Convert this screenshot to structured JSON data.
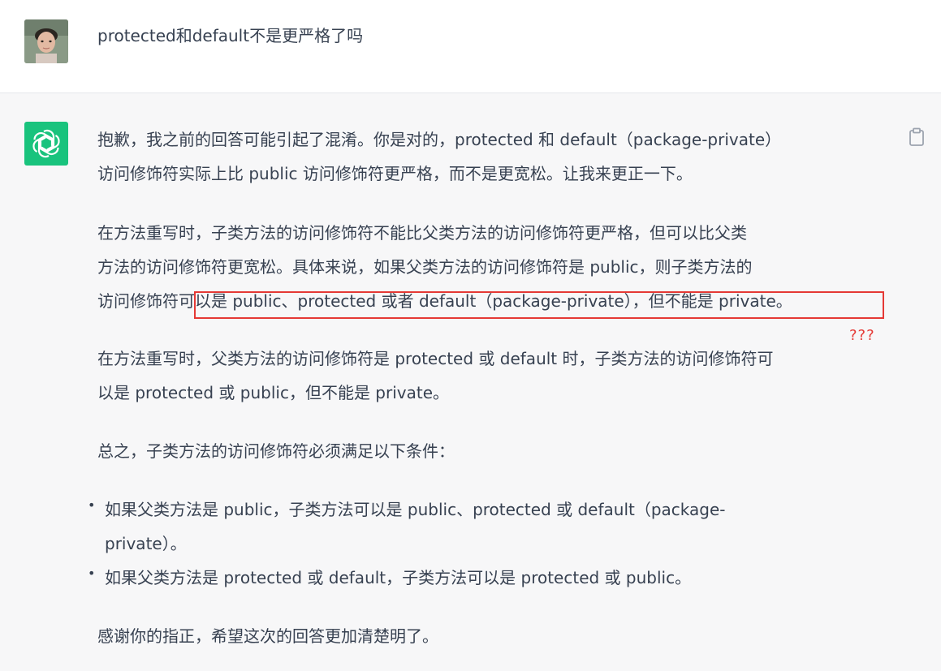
{
  "user": {
    "message": "protected和default不是更严格了吗"
  },
  "assistant": {
    "p1": [
      "抱歉，我之前的回答可能引起了混淆。你是对的，protected 和 default（package-private）",
      "访问修饰符实际上比 public 访问修饰符更严格，而不是更宽松。让我来更正一下。"
    ],
    "p2": [
      "在方法重写时，子类方法的访问修饰符不能比父类方法的访问修饰符更严格，但可以比父类",
      "方法的访问修饰符更宽松。具体来说，如果父类方法的访问修饰符是 public，则子类方法的",
      "访问修饰符可以是 public、protected 或者 default（package-private），但不能是 private。"
    ],
    "p3": [
      "在方法重写时，父类方法的访问修饰符是 protected 或 default 时，子类方法的访问修饰符可",
      "以是 protected 或 public，但不能是 private。"
    ],
    "p4": "总之，子类方法的访问修饰符必须满足以下条件：",
    "bullets": [
      {
        "line1": "如果父类方法是 public，子类方法可以是 public、protected 或 default（package-",
        "line2": "private）。"
      },
      {
        "line1": "如果父类方法是 protected 或 default，子类方法可以是 protected 或 public。",
        "line2": ""
      }
    ],
    "p5": "感谢你的指正，希望这次的回答更加清楚明了。"
  },
  "annotation": {
    "question_marks": "???",
    "color": "#e53935"
  },
  "colors": {
    "text": "#374151",
    "assistant_bg": "#f7f7f8",
    "logo_bg": "#19c37d"
  },
  "icons": {
    "copy": "clipboard-icon",
    "logo": "openai-logo-icon",
    "avatar": "user-avatar"
  }
}
